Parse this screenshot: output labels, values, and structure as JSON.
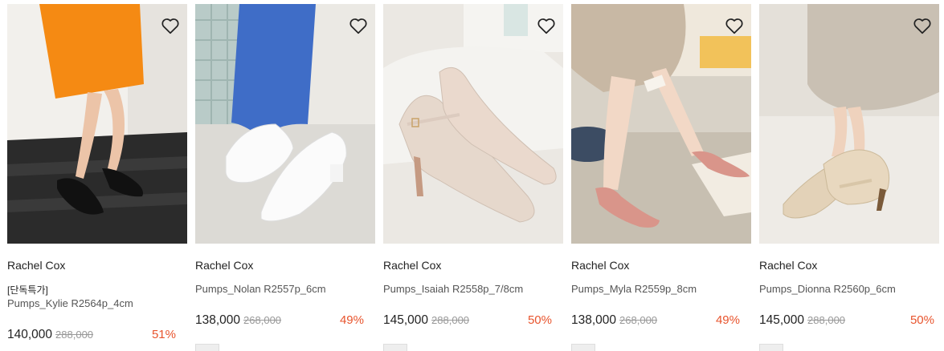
{
  "products": [
    {
      "brand": "Rachel Cox",
      "tag": "[단독특가]",
      "name": "Pumps_Kylie R2564p_4cm",
      "price": "140,000",
      "original_price": "288,000",
      "discount": "51%"
    },
    {
      "brand": "Rachel Cox",
      "tag": "",
      "name": "Pumps_Nolan R2557p_6cm",
      "price": "138,000",
      "original_price": "268,000",
      "discount": "49%"
    },
    {
      "brand": "Rachel Cox",
      "tag": "",
      "name": "Pumps_Isaiah R2558p_7/8cm",
      "price": "145,000",
      "original_price": "288,000",
      "discount": "50%"
    },
    {
      "brand": "Rachel Cox",
      "tag": "",
      "name": "Pumps_Myla R2559p_8cm",
      "price": "138,000",
      "original_price": "268,000",
      "discount": "49%"
    },
    {
      "brand": "Rachel Cox",
      "tag": "",
      "name": "Pumps_Dionna R2560p_6cm",
      "price": "145,000",
      "original_price": "288,000",
      "discount": "50%"
    }
  ],
  "icons": {
    "wishlist": "heart-outline-icon"
  },
  "colors": {
    "discount": "#e8542d",
    "strike": "#999999"
  }
}
